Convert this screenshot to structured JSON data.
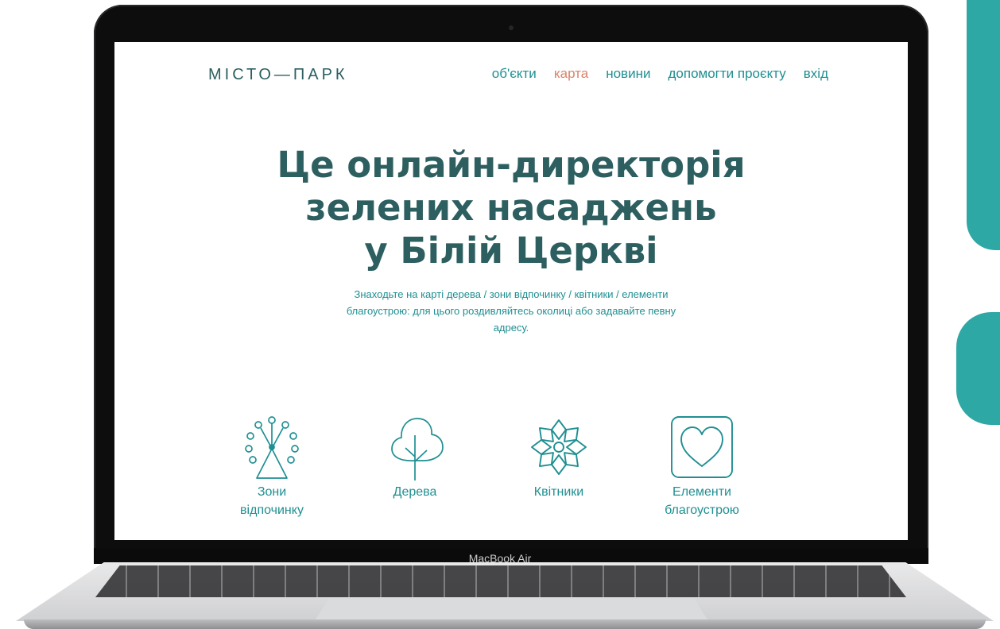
{
  "device": {
    "model_label": "MacBook Air"
  },
  "site": {
    "logo": "МІСТО—ПАРК",
    "nav": [
      {
        "label": "об'єкти",
        "active": false
      },
      {
        "label": "карта",
        "active": true
      },
      {
        "label": "новини",
        "active": false
      },
      {
        "label": "допомогти проєкту",
        "active": false
      },
      {
        "label": "вхід",
        "active": false
      }
    ],
    "hero": {
      "title_lines": [
        "Це онлайн-директорія",
        "зелених насаджень",
        "у Білій Церкві"
      ],
      "subtitle": "Знаходьте на карті дерева / зони відпочинку / квітники / елементи благоустрою: для цього роздивляйтесь околиці або задавайте певну адресу."
    },
    "categories": [
      {
        "label_line1": "Зони",
        "label_line2": "відпочинку",
        "icon": "ferris-wheel-icon"
      },
      {
        "label_line1": "Дерева",
        "label_line2": "",
        "icon": "tree-icon"
      },
      {
        "label_line1": "Квітники",
        "label_line2": "",
        "icon": "flower-icon"
      },
      {
        "label_line1": "Елементи",
        "label_line2": "благоустрою",
        "icon": "heart-icon"
      }
    ]
  },
  "colors": {
    "brand_teal": "#1f8f92",
    "heading": "#2d5f60",
    "active_nav": "#d9836a",
    "decor": "#2ea8a5"
  }
}
